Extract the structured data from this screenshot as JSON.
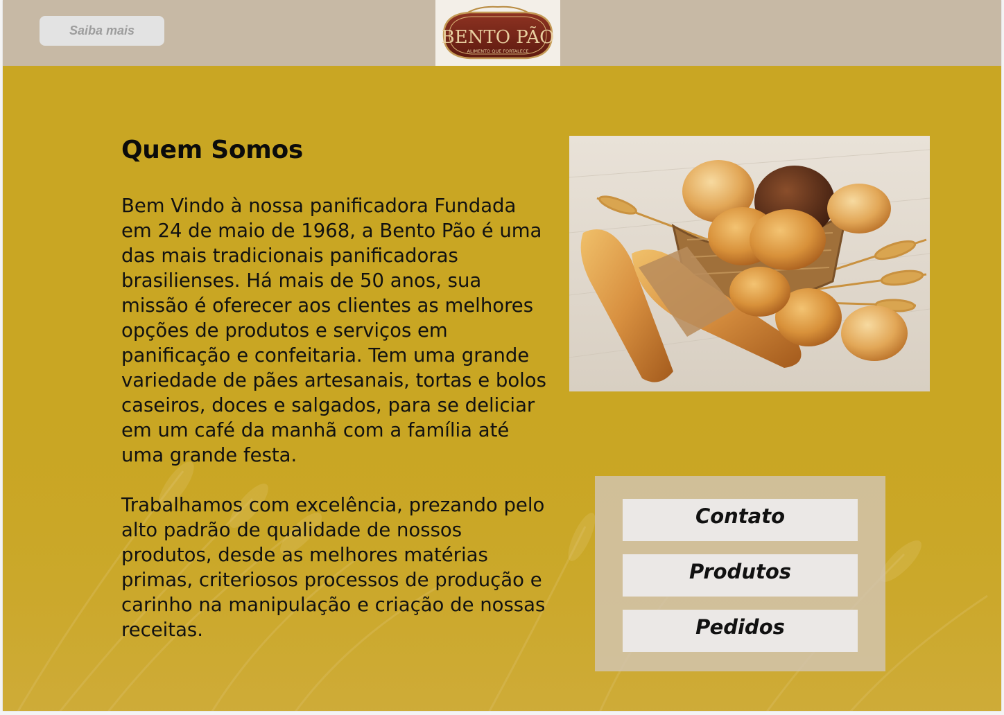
{
  "header": {
    "cta_label": "Saiba mais",
    "logo": {
      "brand": "BENTO PÃO",
      "tagline": "ALIMENTO QUE FORTALECE"
    }
  },
  "about": {
    "title": "Quem Somos",
    "paragraph_1": "Bem Vindo à nossa panificadora Fundada em 24 de maio de 1968, a Bento Pão é uma das mais tradicionais panificadoras brasilienses. Há mais de 50 anos, sua missão é oferecer aos clientes as melhores opções de produtos e serviços em panificação e confeitaria. Tem uma grande variedade de pães artesanais, tortas e bolos caseiros, doces e salgados, para se deliciar em um café da manhã com a família até uma grande festa.",
    "paragraph_2": "Trabalhamos com excelência, prezando pelo alto padrão de qualidade de nossos produtos, desde as melhores matérias primas, criteriosos processos de produção e carinho na manipulação e criação de nossas receitas."
  },
  "nav": {
    "items": [
      {
        "label": "Contato"
      },
      {
        "label": "Produtos"
      },
      {
        "label": "Pedidos"
      }
    ]
  },
  "colors": {
    "header_bg": "#c7b9a5",
    "page_bg": "#c9a623",
    "logo_maroon": "#7a2418",
    "button_bg": "#e3e3e3"
  },
  "icons": {
    "photo": "bread-basket-image",
    "logo": "bento-pao-logo"
  }
}
